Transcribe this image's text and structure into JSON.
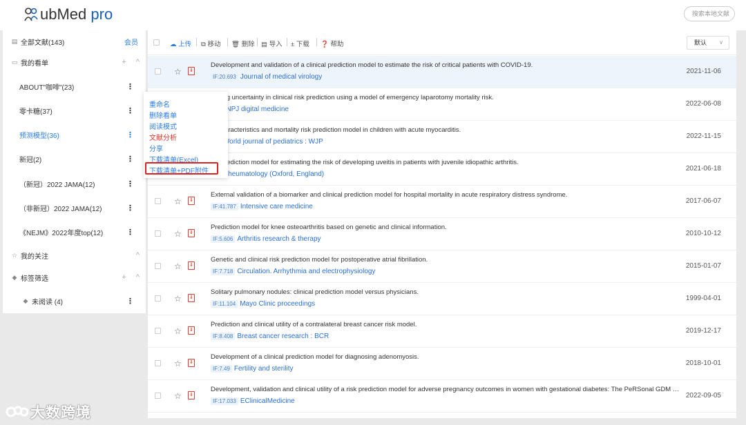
{
  "app": {
    "logo_main": "ubMed",
    "logo_suffix": "pro",
    "search_placeholder": "搜索本地文献"
  },
  "sidebar": {
    "all_docs": "全部文献(143)",
    "vip": "会员",
    "my_lists": "我的看单",
    "plus": "+",
    "caret": "^",
    "lists": [
      {
        "label": "ABOUT\"咖啡\"(23)",
        "active": false
      },
      {
        "label": "零卡糖(37)",
        "active": false
      },
      {
        "label": "预测模型(36)",
        "active": true
      },
      {
        "label": "新冠(2)",
        "active": false
      },
      {
        "label": "（新冠）2022 JAMA(12)",
        "active": false
      },
      {
        "label": "（非新冠）2022 JAMA(12)",
        "active": false
      },
      {
        "label": "《NEJM》2022年度top(12)",
        "active": false
      }
    ],
    "follow": "我的关注",
    "tag_filter": "标签筛选",
    "tags": [
      {
        "label": "未阅读 (4)"
      }
    ]
  },
  "popup_menu": {
    "items": [
      {
        "label": "重命名",
        "color": "blue"
      },
      {
        "label": "删除看单",
        "color": "blue"
      },
      {
        "label": "阅读模式",
        "color": "blue"
      },
      {
        "label": "文献分析",
        "color": "red"
      },
      {
        "label": "分享",
        "color": "blue"
      },
      {
        "label": "下载清单(Excel)",
        "color": "blue"
      },
      {
        "label": "下载清单+PDF附件",
        "color": "blue"
      }
    ],
    "highlight_color": "#e02020"
  },
  "toolbar": {
    "upload": "上传",
    "move": "移动",
    "delete": "删除",
    "import": "导入",
    "download": "下载",
    "help": "帮助",
    "sort": "默认"
  },
  "articles": [
    {
      "title": "Development and validation of a clinical prediction model to estimate the risk of critical patients with COVID-19.",
      "if": "IF:20.693",
      "journal": "Journal of medical virology",
      "date": "2021-11-06",
      "selected": true
    },
    {
      "title": "ighting uncertainty in clinical risk prediction using a model of emergency laparotomy mortality risk.",
      "if": "357",
      "journal": "NPJ digital medicine",
      "date": "2022-06-08",
      "selected": false
    },
    {
      "title": "al characteristics and mortality risk prediction model in children with acute myocarditis.",
      "if": "86",
      "journal": "World journal of pediatrics : WJP",
      "date": "2022-11-15",
      "selected": false
    },
    {
      "title": "cal prediction model for estimating the risk of developing uveitis in patients with juvenile idiopathic arthritis.",
      "if": "46",
      "journal": "Rheumatology (Oxford, England)",
      "date": "2021-06-18",
      "selected": false
    },
    {
      "title": "External validation of a biomarker and clinical prediction model for hospital mortality in acute respiratory distress syndrome.",
      "if": "IF:41.787",
      "journal": "Intensive care medicine",
      "date": "2017-06-07",
      "selected": false
    },
    {
      "title": "Prediction model for knee osteoarthritis based on genetic and clinical information.",
      "if": "IF:5.606",
      "journal": "Arthritis research & therapy",
      "date": "2010-10-12",
      "selected": false
    },
    {
      "title": "Genetic and clinical risk prediction model for postoperative atrial fibrillation.",
      "if": "IF:7.718",
      "journal": "Circulation. Arrhythmia and electrophysiology",
      "date": "2015-01-07",
      "selected": false
    },
    {
      "title": "Solitary pulmonary nodules: clinical prediction model versus physicians.",
      "if": "IF:11.104",
      "journal": "Mayo Clinic proceedings",
      "date": "1999-04-01",
      "selected": false
    },
    {
      "title": "Prediction and clinical utility of a contralateral breast cancer risk model.",
      "if": "IF:8.408",
      "journal": "Breast cancer research : BCR",
      "date": "2019-12-17",
      "selected": false
    },
    {
      "title": "Development of a clinical prediction model for diagnosing adenomyosis.",
      "if": "IF:7.49",
      "journal": "Fertility and sterility",
      "date": "2018-10-01",
      "selected": false
    },
    {
      "title": "Development, validation and clinical utility of a risk prediction model for adverse pregnancy outcomes in women with gestational diabetes: The PeRSonal GDM model.",
      "if": "IF:17.033",
      "journal": "EClinicalMedicine",
      "date": "2022-09-05",
      "selected": false
    }
  ],
  "watermark": {
    "text": "大数跨境"
  },
  "colors": {
    "accent": "#2a7de1",
    "danger": "#e03b2e"
  }
}
